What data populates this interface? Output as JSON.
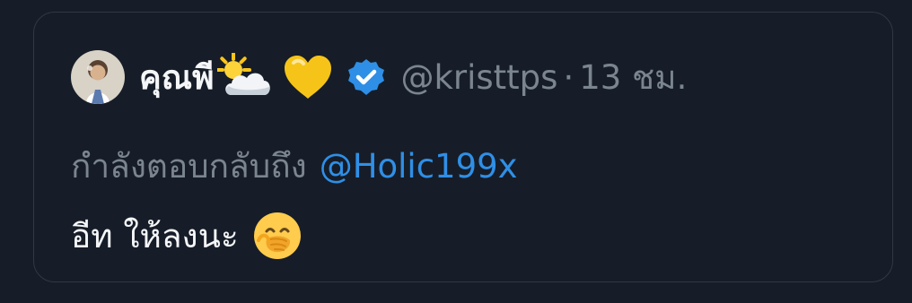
{
  "tweet": {
    "author": {
      "display_name": "คุณพี",
      "name_emojis": [
        "sun-behind-cloud",
        "yellow-heart"
      ],
      "verified": true,
      "handle": "@kristtps",
      "separator": "·",
      "timestamp": "13 ชม."
    },
    "reply": {
      "prefix": "กำลังตอบกลับถึง",
      "target": "@Holic199x"
    },
    "text": "อีท ให้ลงนะ",
    "text_emoji": "face-with-hand-over-mouth",
    "colors": {
      "background": "#161d28",
      "border": "#313843",
      "primary_text": "#f4f6f8",
      "secondary_text": "#7b858f",
      "link": "#2f8fe6",
      "verified_badge": "#2f8fe6"
    }
  }
}
